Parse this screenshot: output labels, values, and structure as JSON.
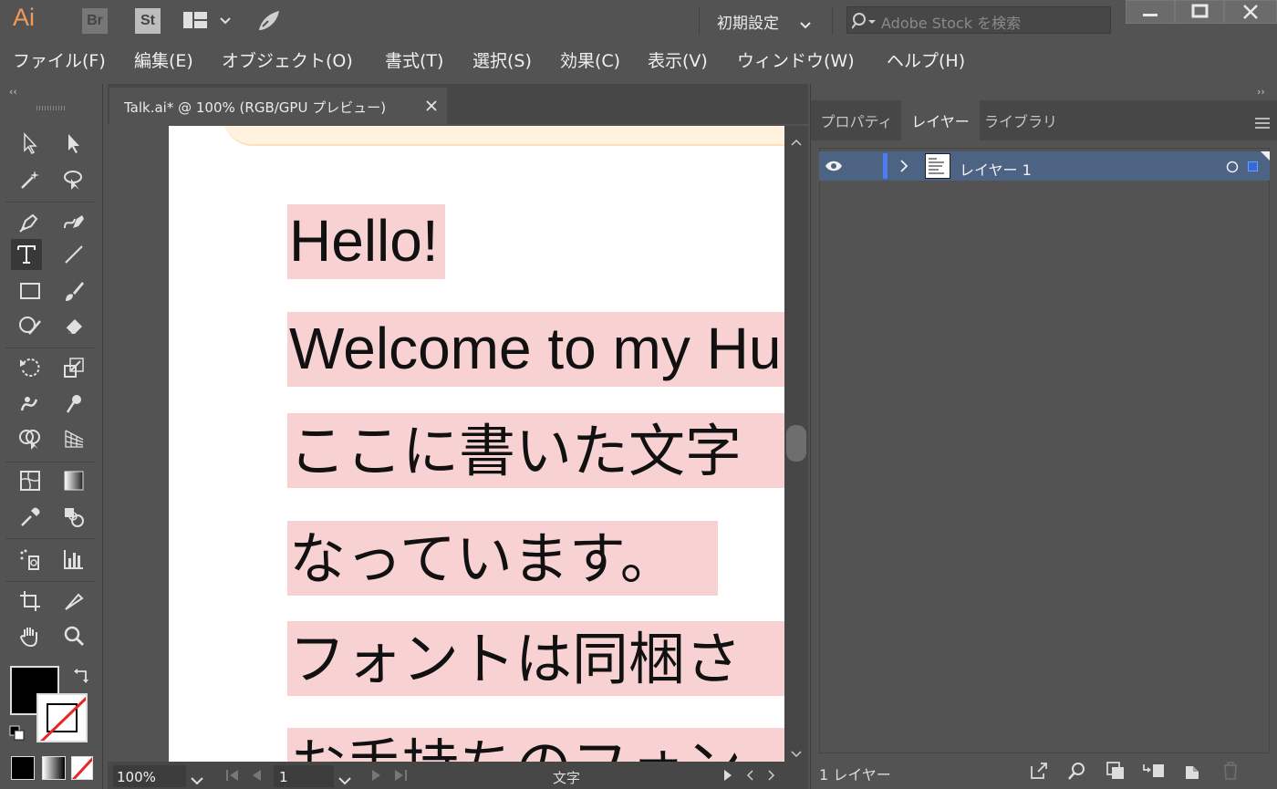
{
  "app": {
    "logo": "Ai",
    "bridge_label": "Br",
    "stock_label": "St",
    "workspace": "初期設定",
    "search_placeholder": "Adobe Stock を検索"
  },
  "menu": [
    "ファイル(F)",
    "編集(E)",
    "オブジェクト(O)",
    "書式(T)",
    "選択(S)",
    "効果(C)",
    "表示(V)",
    "ウィンドウ(W)",
    "ヘルプ(H)"
  ],
  "document": {
    "tab_title": "Talk.ai* @ 100% (RGB/GPU プレビュー)",
    "lines": [
      "Hello!",
      "Welcome to my Hu",
      "ここに書いた文字",
      "なっています。",
      "フォントは同梱さ",
      "お手持ちのフォン"
    ]
  },
  "status": {
    "zoom": "100%",
    "page": "1",
    "tool_name": "文字"
  },
  "panel": {
    "tabs": [
      "プロパティ",
      "レイヤー",
      "ライブラリ"
    ],
    "active_tab": "レイヤー",
    "layer_name": "レイヤー 1",
    "layer_count": "1 レイヤー",
    "layer_color": "#4d7cf6"
  },
  "colors": {
    "text_highlight": "#f8d2d3",
    "selected_row": "#4d6384",
    "logo_orange": "#f29a59"
  }
}
